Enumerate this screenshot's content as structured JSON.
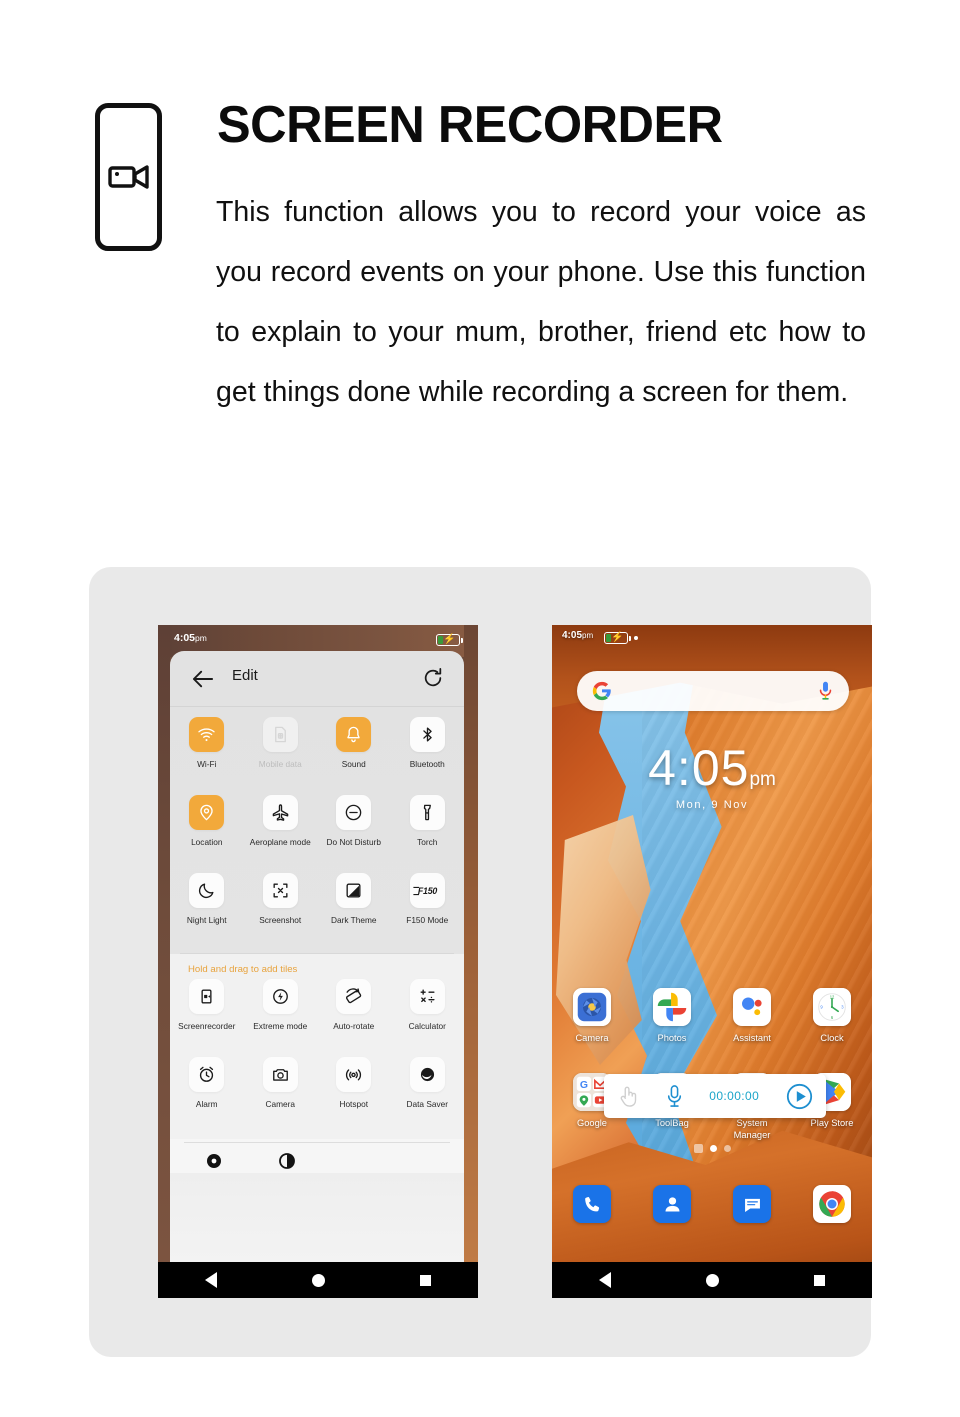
{
  "header": {
    "icon": "video-camera-phone-icon",
    "title": "SCREEN RECORDER",
    "body": "This function allows you to record your voice as you record events on your phone. Use this function to explain to your mum, brother, friend etc how to get things done while recording a screen for them."
  },
  "colors": {
    "accent_orange": "#F2A93B",
    "add_tiles_label": "#E8A33D",
    "rec_timer_teal": "#1CA5C9",
    "card_background": "#E9E9E9",
    "panel_background": "#E2E2E2"
  },
  "left_phone": {
    "status_bar": {
      "time": "4:05",
      "meridiem": "pm",
      "battery_icon": "battery-charging-icon"
    },
    "quick_settings": {
      "back_icon": "arrow-left-icon",
      "title": "Edit",
      "reset_icon": "reset-icon",
      "active_tiles": [
        {
          "label": "Wi-Fi",
          "icon": "wifi-icon",
          "state": "on"
        },
        {
          "label": "Mobile data",
          "icon": "sim-card-icon",
          "state": "disabled"
        },
        {
          "label": "Sound",
          "icon": "bell-icon",
          "state": "on"
        },
        {
          "label": "Bluetooth",
          "icon": "bluetooth-icon",
          "state": "off"
        },
        {
          "label": "Location",
          "icon": "location-pin-icon",
          "state": "on"
        },
        {
          "label": "Aeroplane mode",
          "icon": "airplane-icon",
          "state": "off"
        },
        {
          "label": "Do Not Disturb",
          "icon": "do-not-disturb-icon",
          "state": "off"
        },
        {
          "label": "Torch",
          "icon": "flashlight-icon",
          "state": "off"
        },
        {
          "label": "Night Light",
          "icon": "moon-icon",
          "state": "off"
        },
        {
          "label": "Screenshot",
          "icon": "screenshot-icon",
          "state": "off"
        },
        {
          "label": "Dark Theme",
          "icon": "contrast-square-icon",
          "state": "off"
        },
        {
          "label": "F150 Mode",
          "icon": "f150-logo-icon",
          "state": "off"
        }
      ],
      "add_section_label": "Hold and drag to add tiles",
      "available_tiles": [
        {
          "label": "Screenrecorder",
          "icon": "screen-recorder-icon"
        },
        {
          "label": "Extreme mode",
          "icon": "bolt-circle-icon"
        },
        {
          "label": "Auto-rotate",
          "icon": "auto-rotate-icon"
        },
        {
          "label": "Calculator",
          "icon": "calculator-icon"
        },
        {
          "label": "Alarm",
          "icon": "alarm-clock-icon"
        },
        {
          "label": "Camera",
          "icon": "camera-icon"
        },
        {
          "label": "Hotspot",
          "icon": "hotspot-icon"
        },
        {
          "label": "Data Saver",
          "icon": "data-saver-icon"
        }
      ],
      "partial_tiles": [
        {
          "icon": "eye-dot-icon"
        },
        {
          "icon": "half-contrast-icon"
        }
      ]
    },
    "nav_bar": {
      "back": "triangle-back-icon",
      "home": "circle-home-icon",
      "recents": "square-recents-icon"
    }
  },
  "right_phone": {
    "status_bar": {
      "time": "4:05",
      "meridiem": "pm",
      "battery_icon": "battery-charging-icon"
    },
    "search_bar": {
      "logo": "google-g-icon",
      "mic": "microphone-icon"
    },
    "clock_widget": {
      "time": "4:05",
      "meridiem": "pm",
      "date": "Mon, 9 Nov"
    },
    "app_row_1": [
      {
        "label": "Camera",
        "icon": "camera-app-icon"
      },
      {
        "label": "Photos",
        "icon": "google-photos-icon"
      },
      {
        "label": "Assistant",
        "icon": "google-assistant-icon"
      },
      {
        "label": "Clock",
        "icon": "clock-app-icon"
      }
    ],
    "app_row_2": [
      {
        "label": "Google",
        "icon": "google-folder-icon"
      },
      {
        "label": "ToolBag",
        "icon": "toolbag-icon"
      },
      {
        "label": "System Manager",
        "icon": "system-manager-icon"
      },
      {
        "label": "Play Store",
        "icon": "google-play-icon"
      }
    ],
    "recorder_toolbar": {
      "touch_icon": "hand-tap-icon",
      "mic_icon": "microphone-icon",
      "timer": "00:00:00",
      "record_icon": "play-record-icon"
    },
    "page_indicator": {
      "dots": 2,
      "active_index": 0
    },
    "dock": [
      {
        "label": "Phone",
        "icon": "phone-icon"
      },
      {
        "label": "Contacts",
        "icon": "contacts-icon"
      },
      {
        "label": "Messages",
        "icon": "messages-icon"
      },
      {
        "label": "Chrome",
        "icon": "chrome-icon"
      }
    ],
    "nav_bar": {
      "back": "triangle-back-icon",
      "home": "circle-home-icon",
      "recents": "square-recents-icon"
    }
  }
}
